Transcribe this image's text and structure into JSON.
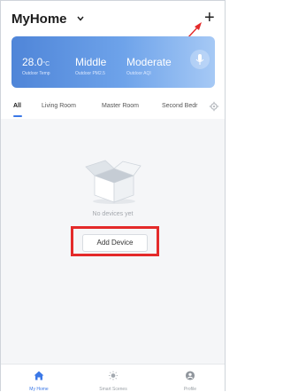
{
  "header": {
    "home_title": "MyHome",
    "home_chevron_icon": "chevron-down-icon",
    "add_symbol": "+",
    "annotation_arrow_color": "#e42a2a"
  },
  "weather": {
    "temperature": {
      "value": "28.0",
      "unit": "°C",
      "label": "Outdoor Temp"
    },
    "pm25": {
      "value": "Middle",
      "label": "Outdoor PM2.5"
    },
    "aqi": {
      "value": "Moderate",
      "label": "Outdoor AQI"
    },
    "mic_icon": "microphone-icon",
    "gradient_start": "#4f85d8",
    "gradient_end": "#a6c9f5"
  },
  "tabs": {
    "items": [
      {
        "label": "All",
        "active": true
      },
      {
        "label": "Living Room",
        "active": false
      },
      {
        "label": "Master Room",
        "active": false
      },
      {
        "label": "Second Bedr",
        "active": false
      }
    ],
    "settings_icon": "gear-icon",
    "accent": "#3b78e7"
  },
  "empty_state": {
    "icon": "empty-box-icon",
    "message": "No devices yet",
    "button_label": "Add Device",
    "highlight_color": "#e42a2a"
  },
  "bottom_nav": {
    "items": [
      {
        "label": "My Home",
        "icon": "home-icon",
        "active": true
      },
      {
        "label": "Smart Scenes",
        "icon": "sun-icon",
        "active": false
      },
      {
        "label": "Profile",
        "icon": "profile-icon",
        "active": false
      }
    ]
  }
}
